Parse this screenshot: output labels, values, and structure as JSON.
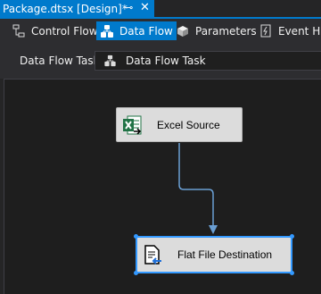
{
  "document_tab": {
    "title": "Package.dtsx [Design]*",
    "pin_glyph": "⊸",
    "close_glyph": "✕"
  },
  "designer_tabs": [
    {
      "label": "Control Flow",
      "icon": "control-flow-icon",
      "active": false
    },
    {
      "label": "Data Flow",
      "icon": "data-flow-icon",
      "active": true
    },
    {
      "label": "Parameters",
      "icon": "parameters-icon",
      "active": false
    },
    {
      "label": "Event Han",
      "icon": "event-handlers-icon",
      "active": false
    }
  ],
  "task_bar": {
    "label": "Data Flow Task:",
    "selected": "Data Flow Task"
  },
  "components": {
    "source": {
      "label": "Excel Source",
      "icon": "excel-source-icon"
    },
    "destination": {
      "label": "Flat File Destination",
      "icon": "flat-file-destination-icon"
    }
  },
  "colors": {
    "accent": "#007acc",
    "selection": "#3399ff",
    "connector": "#6a9fd4",
    "excel_green": "#217346"
  }
}
